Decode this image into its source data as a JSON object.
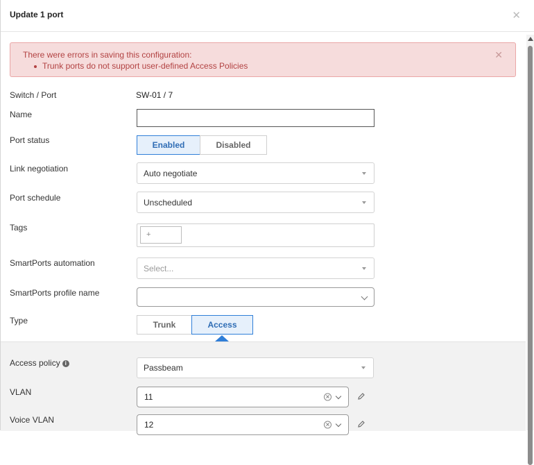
{
  "dialog": {
    "title": "Update 1 port",
    "close_icon": "close-icon"
  },
  "alert": {
    "message": "There were errors in saving this configuration:",
    "errors": [
      "Trunk ports do not support user-defined Access Policies"
    ]
  },
  "fields": {
    "switch_port": {
      "label": "Switch / Port",
      "value": "SW-01 / 7"
    },
    "name": {
      "label": "Name",
      "value": ""
    },
    "port_status": {
      "label": "Port status",
      "options": [
        "Enabled",
        "Disabled"
      ],
      "selected": "Enabled"
    },
    "link_negotiation": {
      "label": "Link negotiation",
      "value": "Auto negotiate"
    },
    "port_schedule": {
      "label": "Port schedule",
      "value": "Unscheduled"
    },
    "tags": {
      "label": "Tags",
      "add_label": "+"
    },
    "smartports_automation": {
      "label": "SmartPorts automation",
      "placeholder": "Select..."
    },
    "smartports_profile": {
      "label": "SmartPorts profile name",
      "value": ""
    },
    "type": {
      "label": "Type",
      "options": [
        "Trunk",
        "Access"
      ],
      "selected": "Access"
    }
  },
  "access_section": {
    "access_policy": {
      "label": "Access policy",
      "value": "Passbeam"
    },
    "vlan": {
      "label": "VLAN",
      "value": "11"
    },
    "voice_vlan": {
      "label": "Voice VLAN",
      "value": "12"
    }
  },
  "colors": {
    "accent": "#2f7ed8",
    "error_bg": "#f6dcdc",
    "error_text": "#b24242"
  }
}
